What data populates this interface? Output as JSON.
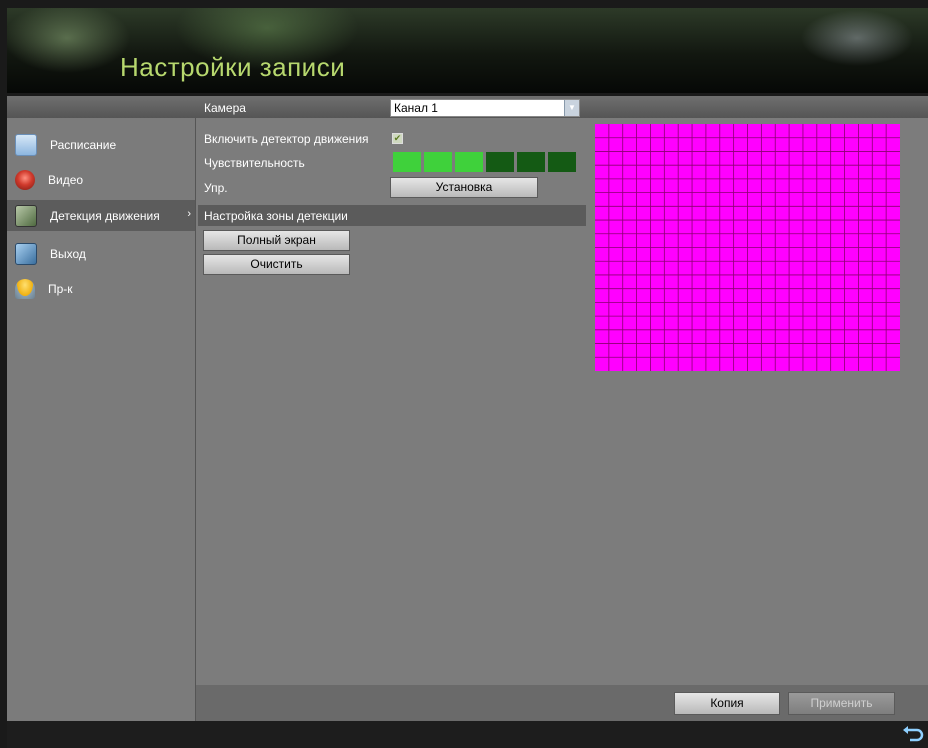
{
  "header": {
    "title": "Настройки записи"
  },
  "sidebar": {
    "items": [
      {
        "label": "Расписание",
        "icon": "calendar-icon",
        "color": "#9bc3e8"
      },
      {
        "label": "Видео",
        "icon": "record-icon",
        "color": "#d03a2c"
      },
      {
        "label": "Детекция движения",
        "icon": "motion-icon",
        "color": "#6a8a5a",
        "active": true,
        "arrow": "›"
      },
      {
        "label": "Выход",
        "icon": "output-icon",
        "color": "#4a7fb0"
      },
      {
        "label": "Пр-к",
        "icon": "umbrella-icon",
        "color": "#f0c020"
      }
    ]
  },
  "camera": {
    "label": "Камера",
    "value": "Канал 1"
  },
  "motion": {
    "enable_label": "Включить детектор движения",
    "enabled": true,
    "sensitivity_label": "Чувствительность",
    "sensitivity_level": 3,
    "sensitivity_max": 6,
    "sensitivity_on_color": "#3fd13b",
    "sensitivity_off_color": "#145a14",
    "handling_label": "Упр.",
    "handling_button": "Установка"
  },
  "zone": {
    "header": "Настройка зоны детекции",
    "fullscreen_button": "Полный экран",
    "clear_button": "Очистить",
    "grid_color": "#ff00ff",
    "grid_line_color": "#8a0070",
    "grid_cols": 22,
    "grid_rows": 18
  },
  "footer": {
    "copy_button": "Копия",
    "apply_button": "Применить"
  }
}
